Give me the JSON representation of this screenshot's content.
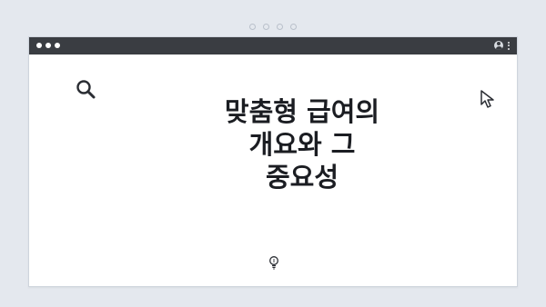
{
  "headline": {
    "lines": [
      "맞춤형 급여의",
      "개요와 그",
      "중요성"
    ]
  },
  "icons": {
    "search": "search-icon",
    "cursor": "cursor-icon",
    "bulb": "lightbulb-icon",
    "user": "user-icon",
    "menu": "kebab-menu-icon"
  },
  "colors": {
    "background": "#e4e8ee",
    "titlebar": "#3a3d42",
    "window": "#ffffff",
    "text": "#1b1d22"
  }
}
